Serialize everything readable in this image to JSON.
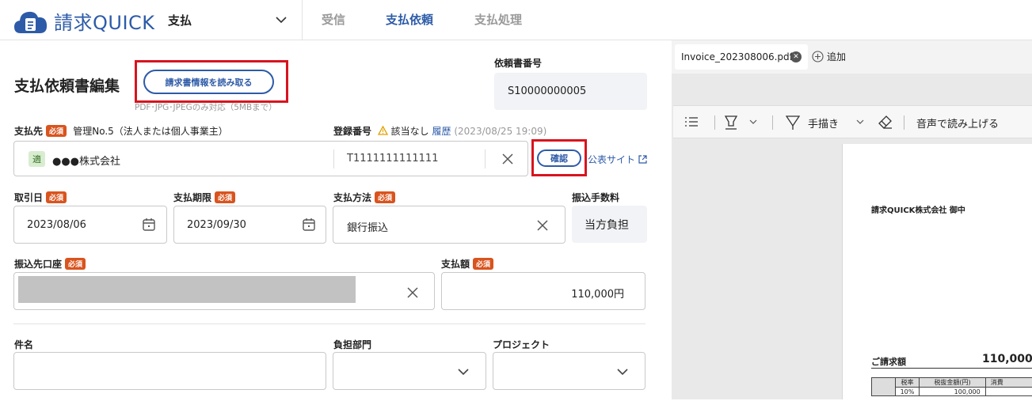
{
  "header": {
    "app_name": "請求QUICK",
    "module": "支払",
    "tabs": [
      {
        "label": "受信"
      },
      {
        "label": "支払依頼"
      },
      {
        "label": "支払処理"
      }
    ]
  },
  "form": {
    "title": "支払依頼書編集",
    "read_button": "請求書情報を読み取る",
    "read_hint": "PDF･JPG･JPEGのみ対応（5MBまで）",
    "request_no_label": "依頼書番号",
    "request_no_value": "S10000000005",
    "payee_label": "支払先",
    "required": "必須",
    "payee_mgmt": "管理No.5（法人または個人事業主）",
    "payee_badge": "適",
    "payee_name": "●●●株式会社",
    "reg_label": "登録番号",
    "reg_status": "該当なし",
    "reg_history": "履歴",
    "reg_date": "(2023/08/25 19:09)",
    "reg_value": "T1111111111111",
    "confirm_button": "確認",
    "public_site": "公表サイト",
    "trade_date_label": "取引日",
    "trade_date": "2023/08/06",
    "due_date_label": "支払期限",
    "due_date": "2023/09/30",
    "method_label": "支払方法",
    "method_value": "銀行振込",
    "fee_label": "振込手数料",
    "fee_value": "当方負担",
    "account_label": "振込先口座",
    "amount_label": "支払額",
    "amount_value": "110,000円",
    "subject_label": "件名",
    "dept_label": "負担部門",
    "project_label": "プロジェクト"
  },
  "viewer": {
    "file_tab": "Invoice_202308006.pdf",
    "add_label": "追加",
    "handwrite": "手描き",
    "read_aloud": "音声で読み上げる",
    "doc_addressee": "請求QUICK株式会社  御中",
    "doc_amount_label": "ご請求額",
    "doc_amount_value": "110,000",
    "doc_table_headers": [
      "税率",
      "税抜金額(円)",
      "消費"
    ],
    "doc_table_row": [
      "10%",
      "100,000",
      ""
    ]
  },
  "colors": {
    "brand": "#2d5ba8",
    "required_badge": "#d9541e",
    "highlight": "#d8141e"
  }
}
